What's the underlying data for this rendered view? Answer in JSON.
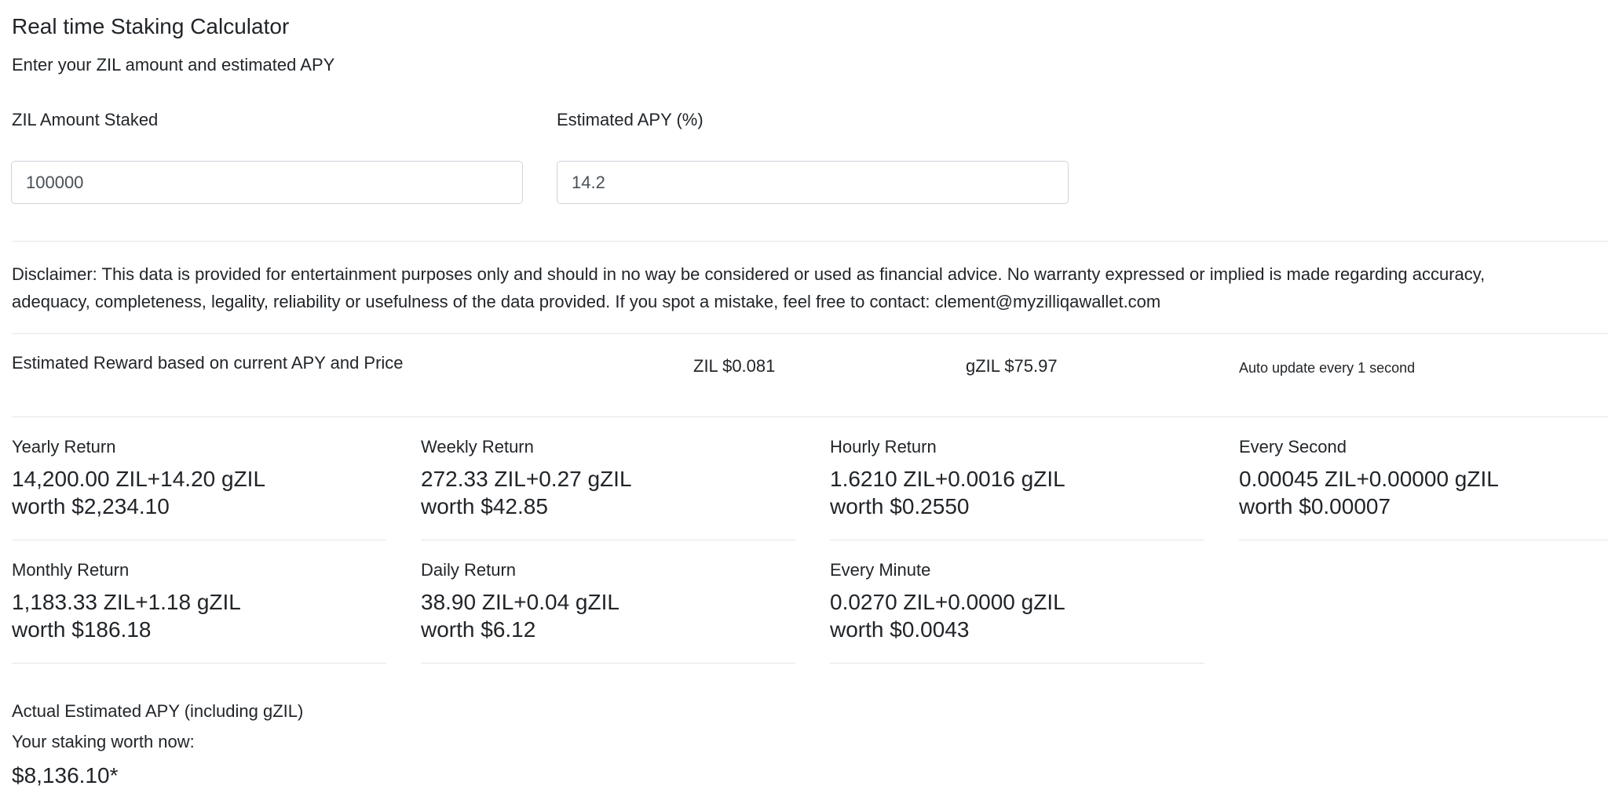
{
  "header": {
    "title": "Real time Staking Calculator",
    "subtitle": "Enter your ZIL amount and estimated APY"
  },
  "form": {
    "zil_label": "ZIL Amount Staked",
    "zil_value": "100000",
    "apy_label": "Estimated APY (%)",
    "apy_value": "14.2"
  },
  "disclaimer": {
    "line1": "Disclaimer: This data is provided for entertainment purposes only and should in no way be considered or used as financial advice. No warranty expressed or implied is made regarding accuracy,",
    "line2": "adequacy, completeness, legality, reliability or usefulness of the data provided. If you spot a mistake, feel free to contact: clement@myzilliqawallet.com"
  },
  "reward": {
    "label": "Estimated Reward based on current APY and Price",
    "zil_price": "ZIL $0.081",
    "gzil_price": "gZIL $75.97",
    "auto_update": "Auto update every 1 second"
  },
  "returns": {
    "yearly": {
      "title": "Yearly Return",
      "amount": "14,200.00 ZIL+14.20 gZIL",
      "worth": "worth $2,234.10"
    },
    "weekly": {
      "title": "Weekly Return",
      "amount": "272.33 ZIL+0.27 gZIL",
      "worth": "worth $42.85"
    },
    "hourly": {
      "title": "Hourly Return",
      "amount": "1.6210 ZIL+0.0016 gZIL",
      "worth": "worth $0.2550"
    },
    "second": {
      "title": "Every Second",
      "amount": "0.00045 ZIL+0.00000 gZIL",
      "worth": "worth $0.00007"
    },
    "monthly": {
      "title": "Monthly Return",
      "amount": "1,183.33 ZIL+1.18 gZIL",
      "worth": "worth $186.18"
    },
    "daily": {
      "title": "Daily Return",
      "amount": "38.90 ZIL+0.04 gZIL",
      "worth": "worth $6.12"
    },
    "minute": {
      "title": "Every Minute",
      "amount": "0.0270 ZIL+0.0000 gZIL",
      "worth": "worth $0.0043"
    }
  },
  "summary": {
    "actual_apy_label": "Actual Estimated APY (including gZIL)",
    "worth_now_label": "Your staking worth now:",
    "worth_now_value": "$8,136.10*"
  }
}
